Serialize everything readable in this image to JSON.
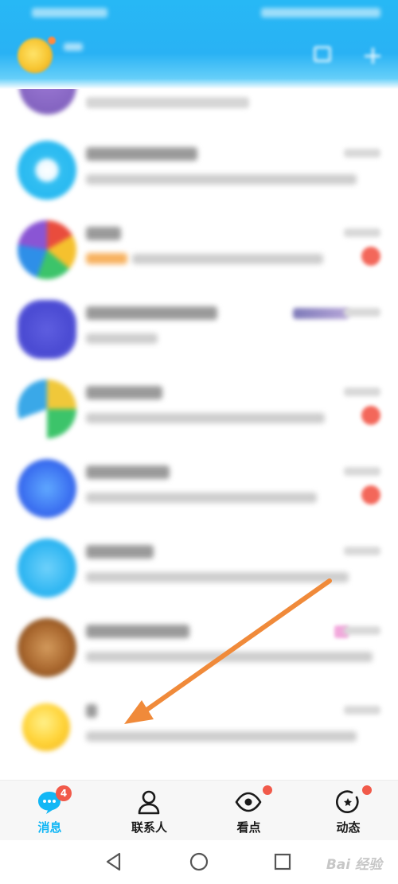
{
  "tabs": [
    {
      "label": "消息",
      "icon": "chat-bubble-icon",
      "badge": "4",
      "active": true
    },
    {
      "label": "联系人",
      "icon": "person-icon",
      "badge": "",
      "active": false
    },
    {
      "label": "看点",
      "icon": "eye-icon",
      "badge": "",
      "active": false
    },
    {
      "label": "动态",
      "icon": "star-circle-icon",
      "badge": "",
      "active": false
    }
  ],
  "colors": {
    "brand": "#12b7f5",
    "header": "#29b2f4",
    "badge": "#f15a4a",
    "arrow": "#f08a3a"
  },
  "watermark": "Bai 经验"
}
